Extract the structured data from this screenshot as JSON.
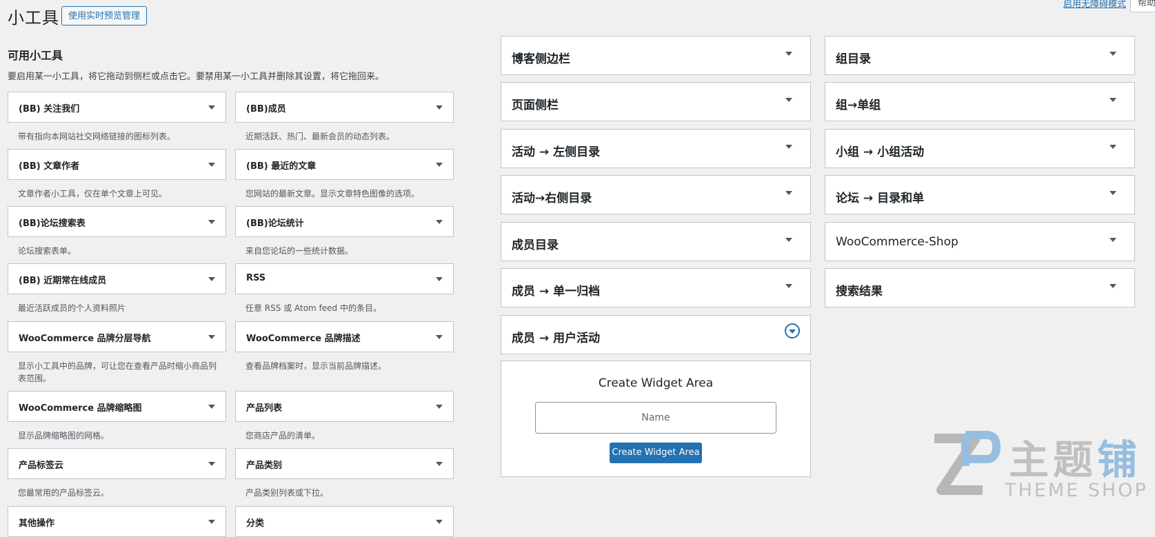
{
  "header": {
    "title": "小工具",
    "live_preview_button": "使用实时预览管理",
    "accessibility_link": "启用无障碍模式",
    "help_tab": "帮助"
  },
  "available": {
    "title": "可用小工具",
    "description": "要启用某一小工具，将它拖动到侧栏或点击它。要禁用某一小工具并删除其设置，将它拖回来。",
    "widgets": [
      {
        "title": "(BB) 关注我们",
        "desc": "带有指向本网站社交网络链接的图标列表。"
      },
      {
        "title": "(BB)成员",
        "desc": "近期活跃、热门、最新会员的动态列表。"
      },
      {
        "title": "(BB) 文章作者",
        "desc": "文章作者小工具，仅在单个文章上可见。"
      },
      {
        "title": "(BB) 最近的文章",
        "desc": "您网站的最新文章。显示文章特色图像的选项。"
      },
      {
        "title": "(BB)论坛搜索表",
        "desc": "论坛搜索表单。"
      },
      {
        "title": "(BB)论坛统计",
        "desc": "来自您论坛的一些统计数据。"
      },
      {
        "title": "(BB) 近期常在线成员",
        "desc": "最近活跃成员的个人资料照片"
      },
      {
        "title": "RSS",
        "desc": "任意 RSS 或 Atom feed 中的条目。"
      },
      {
        "title": "WooCommerce 品牌分层导航",
        "desc": "显示小工具中的品牌，可让您在查看产品时缩小商品列表范围。"
      },
      {
        "title": "WooCommerce 品牌描述",
        "desc": "查看品牌档案时，显示当前品牌描述。"
      },
      {
        "title": "WooCommerce 品牌缩略图",
        "desc": "显示品牌缩略图的网格。"
      },
      {
        "title": "产品列表",
        "desc": "您商店产品的清单。"
      },
      {
        "title": "产品标签云",
        "desc": "您最常用的产品标签云。"
      },
      {
        "title": "产品类别",
        "desc": "产品类别列表或下拉。"
      },
      {
        "title": "其他操作",
        "desc": ""
      },
      {
        "title": "分类",
        "desc": ""
      }
    ]
  },
  "sidebars": {
    "left": [
      "博客侧边栏",
      "页面侧栏",
      "活动 → 左侧目录",
      "活动→右侧目录",
      "成员目录",
      "成员 → 单一归档",
      "成员 → 用户活动"
    ],
    "right": [
      "组目录",
      "组→单组",
      "小组 → 小组活动",
      "论坛 → 目录和单",
      "WooCommerce-Shop",
      "搜索结果"
    ]
  },
  "create_area": {
    "title": "Create Widget Area",
    "name_placeholder": "Name",
    "button_label": "Create Widget Area"
  },
  "watermark": {
    "chinese_prefix": "主题",
    "chinese_last": "铺",
    "english": "THEME SHOP"
  },
  "colors": {
    "accent": "#2271b1",
    "background": "#f0f0f1",
    "border": "#c3c4c7"
  }
}
